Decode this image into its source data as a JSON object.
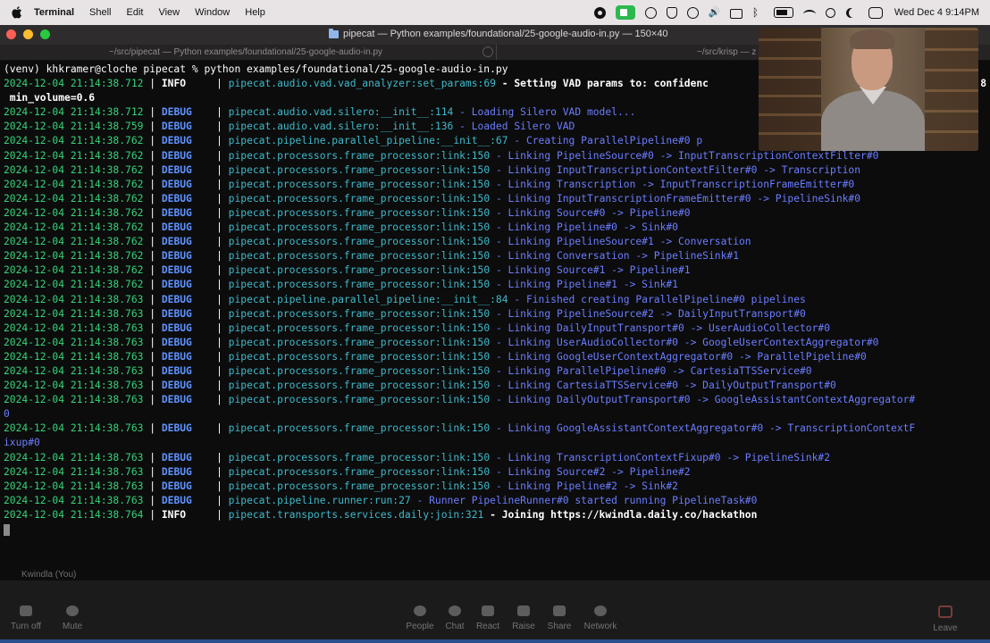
{
  "menubar": {
    "app": "Terminal",
    "menus": [
      "Shell",
      "Edit",
      "View",
      "Window",
      "Help"
    ],
    "datetime": "Wed Dec 4  9:14PM",
    "status_icons": [
      "record-icon",
      "camera-icon",
      "circle-icon",
      "shield-icon",
      "play-icon",
      "speaker-icon",
      "card-icon",
      "bluetooth-icon",
      "battery-icon",
      "wifi-icon",
      "search-icon",
      "focus-moon-icon",
      "control-center-icon"
    ]
  },
  "window": {
    "title": "pipecat — Python examples/foundational/25-google-audio-in.py — 150×40"
  },
  "tabs": [
    {
      "label": "~/src/pipecat — Python examples/foundational/25-google-audio-in.py"
    },
    {
      "label": "~/src/krisp — z"
    }
  ],
  "terminal": {
    "prompt": "(venv) khkramer@cloche pipecat % python examples/foundational/25-google-audio-in.py",
    "lines": [
      {
        "ts": "2024-12-04 21:14:38.712",
        "level": "INFO",
        "module": "pipecat.audio.vad.vad_analyzer:set_params:69",
        "msg": "Setting VAD params to: confidenc",
        "tail": "8"
      },
      {
        "cont": " min_volume=0.6"
      },
      {
        "ts": "2024-12-04 21:14:38.712",
        "level": "DEBUG",
        "module": "pipecat.audio.vad.silero:__init__:114",
        "msg": "Loading Silero VAD model..."
      },
      {
        "ts": "2024-12-04 21:14:38.759",
        "level": "DEBUG",
        "module": "pipecat.audio.vad.silero:__init__:136",
        "msg": "Loaded Silero VAD"
      },
      {
        "ts": "2024-12-04 21:14:38.762",
        "level": "DEBUG",
        "module": "pipecat.pipeline.parallel_pipeline:__init__:67",
        "msg": "Creating ParallelPipeline#0 p"
      },
      {
        "ts": "2024-12-04 21:14:38.762",
        "level": "DEBUG",
        "module": "pipecat.processors.frame_processor:link:150",
        "msg": "Linking PipelineSource#0 -> InputTranscriptionContextFilter#0"
      },
      {
        "ts": "2024-12-04 21:14:38.762",
        "level": "DEBUG",
        "module": "pipecat.processors.frame_processor:link:150",
        "msg": "Linking InputTranscriptionContextFilter#0 -> Transcription"
      },
      {
        "ts": "2024-12-04 21:14:38.762",
        "level": "DEBUG",
        "module": "pipecat.processors.frame_processor:link:150",
        "msg": "Linking Transcription -> InputTranscriptionFrameEmitter#0"
      },
      {
        "ts": "2024-12-04 21:14:38.762",
        "level": "DEBUG",
        "module": "pipecat.processors.frame_processor:link:150",
        "msg": "Linking InputTranscriptionFrameEmitter#0 -> PipelineSink#0"
      },
      {
        "ts": "2024-12-04 21:14:38.762",
        "level": "DEBUG",
        "module": "pipecat.processors.frame_processor:link:150",
        "msg": "Linking Source#0 -> Pipeline#0"
      },
      {
        "ts": "2024-12-04 21:14:38.762",
        "level": "DEBUG",
        "module": "pipecat.processors.frame_processor:link:150",
        "msg": "Linking Pipeline#0 -> Sink#0"
      },
      {
        "ts": "2024-12-04 21:14:38.762",
        "level": "DEBUG",
        "module": "pipecat.processors.frame_processor:link:150",
        "msg": "Linking PipelineSource#1 -> Conversation"
      },
      {
        "ts": "2024-12-04 21:14:38.762",
        "level": "DEBUG",
        "module": "pipecat.processors.frame_processor:link:150",
        "msg": "Linking Conversation -> PipelineSink#1"
      },
      {
        "ts": "2024-12-04 21:14:38.762",
        "level": "DEBUG",
        "module": "pipecat.processors.frame_processor:link:150",
        "msg": "Linking Source#1 -> Pipeline#1"
      },
      {
        "ts": "2024-12-04 21:14:38.762",
        "level": "DEBUG",
        "module": "pipecat.processors.frame_processor:link:150",
        "msg": "Linking Pipeline#1 -> Sink#1"
      },
      {
        "ts": "2024-12-04 21:14:38.763",
        "level": "DEBUG",
        "module": "pipecat.pipeline.parallel_pipeline:__init__:84",
        "msg": "Finished creating ParallelPipeline#0 pipelines"
      },
      {
        "ts": "2024-12-04 21:14:38.763",
        "level": "DEBUG",
        "module": "pipecat.processors.frame_processor:link:150",
        "msg": "Linking PipelineSource#2 -> DailyInputTransport#0"
      },
      {
        "ts": "2024-12-04 21:14:38.763",
        "level": "DEBUG",
        "module": "pipecat.processors.frame_processor:link:150",
        "msg": "Linking DailyInputTransport#0 -> UserAudioCollector#0"
      },
      {
        "ts": "2024-12-04 21:14:38.763",
        "level": "DEBUG",
        "module": "pipecat.processors.frame_processor:link:150",
        "msg": "Linking UserAudioCollector#0 -> GoogleUserContextAggregator#0"
      },
      {
        "ts": "2024-12-04 21:14:38.763",
        "level": "DEBUG",
        "module": "pipecat.processors.frame_processor:link:150",
        "msg": "Linking GoogleUserContextAggregator#0 -> ParallelPipeline#0"
      },
      {
        "ts": "2024-12-04 21:14:38.763",
        "level": "DEBUG",
        "module": "pipecat.processors.frame_processor:link:150",
        "msg": "Linking ParallelPipeline#0 -> CartesiaTTSService#0"
      },
      {
        "ts": "2024-12-04 21:14:38.763",
        "level": "DEBUG",
        "module": "pipecat.processors.frame_processor:link:150",
        "msg": "Linking CartesiaTTSService#0 -> DailyOutputTransport#0"
      },
      {
        "ts": "2024-12-04 21:14:38.763",
        "level": "DEBUG",
        "module": "pipecat.processors.frame_processor:link:150",
        "msg": "Linking DailyOutputTransport#0 -> GoogleAssistantContextAggregator#"
      },
      {
        "cont_debug": "0"
      },
      {
        "ts": "2024-12-04 21:14:38.763",
        "level": "DEBUG",
        "module": "pipecat.processors.frame_processor:link:150",
        "msg": "Linking GoogleAssistantContextAggregator#0 -> TranscriptionContextF"
      },
      {
        "cont_debug": "ixup#0"
      },
      {
        "ts": "2024-12-04 21:14:38.763",
        "level": "DEBUG",
        "module": "pipecat.processors.frame_processor:link:150",
        "msg": "Linking TranscriptionContextFixup#0 -> PipelineSink#2"
      },
      {
        "ts": "2024-12-04 21:14:38.763",
        "level": "DEBUG",
        "module": "pipecat.processors.frame_processor:link:150",
        "msg": "Linking Source#2 -> Pipeline#2"
      },
      {
        "ts": "2024-12-04 21:14:38.763",
        "level": "DEBUG",
        "module": "pipecat.processors.frame_processor:link:150",
        "msg": "Linking Pipeline#2 -> Sink#2"
      },
      {
        "ts": "2024-12-04 21:14:38.763",
        "level": "DEBUG",
        "module": "pipecat.pipeline.runner:run:27",
        "msg": "Runner PipelineRunner#0 started running PipelineTask#0"
      },
      {
        "ts": "2024-12-04 21:14:38.764",
        "level": "INFO",
        "module": "pipecat.transports.services.daily:join:321",
        "msg": "Joining https://kwindla.daily.co/hackathon"
      }
    ]
  },
  "zoom": {
    "participant_name": "Kwindla (You)",
    "controls_left": [
      {
        "label": "Turn off",
        "icon": "video-camera-icon"
      },
      {
        "label": "Mute",
        "icon": "microphone-icon"
      }
    ],
    "controls_center": [
      {
        "label": "People",
        "icon": "people-icon"
      },
      {
        "label": "Chat",
        "icon": "chat-icon"
      },
      {
        "label": "React",
        "icon": "react-icon"
      },
      {
        "label": "Raise",
        "icon": "raise-hand-icon"
      },
      {
        "label": "Share",
        "icon": "share-icon"
      },
      {
        "label": "Network",
        "icon": "network-icon"
      }
    ],
    "control_right": {
      "label": "Leave",
      "icon": "leave-icon"
    }
  },
  "colors": {
    "timestamp": "#36d27a",
    "debug_level": "#5f93ff",
    "module": "#3fbacb",
    "debug_message": "#6b7dff",
    "info_text": "#ffffff"
  }
}
